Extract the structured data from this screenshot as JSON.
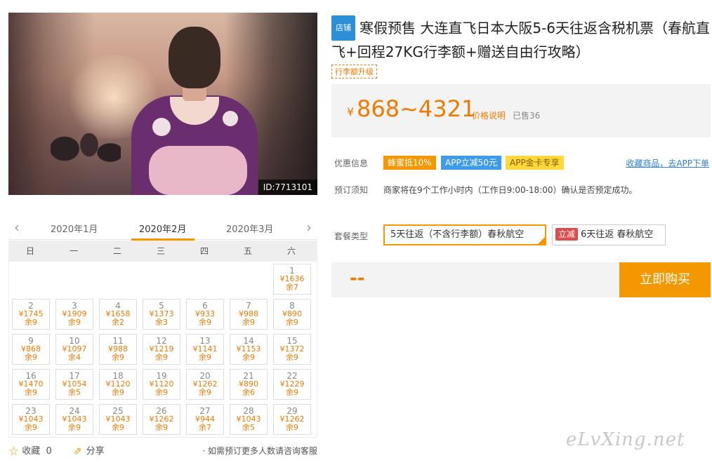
{
  "photo": {
    "id_label": "ID:7713101"
  },
  "calendar": {
    "months": [
      "2020年1月",
      "2020年2月",
      "2020年3月"
    ],
    "weekdays": [
      "日",
      "一",
      "二",
      "三",
      "四",
      "五",
      "六"
    ],
    "prev_arrow": "‹",
    "next_arrow": "›",
    "days": [
      {
        "n": "1",
        "p": "¥1636",
        "r": "余7"
      },
      {
        "n": "2",
        "p": "¥1745",
        "r": "余9"
      },
      {
        "n": "3",
        "p": "¥1909",
        "r": "余9"
      },
      {
        "n": "4",
        "p": "¥1658",
        "r": "余2"
      },
      {
        "n": "5",
        "p": "¥1373",
        "r": "余3"
      },
      {
        "n": "6",
        "p": "¥933",
        "r": "余9"
      },
      {
        "n": "7",
        "p": "¥988",
        "r": "余9"
      },
      {
        "n": "8",
        "p": "¥890",
        "r": "余9"
      },
      {
        "n": "9",
        "p": "¥868",
        "r": "余9"
      },
      {
        "n": "10",
        "p": "¥1097",
        "r": "余4"
      },
      {
        "n": "11",
        "p": "¥988",
        "r": "余9"
      },
      {
        "n": "12",
        "p": "¥1219",
        "r": "余9"
      },
      {
        "n": "13",
        "p": "¥1141",
        "r": "余9"
      },
      {
        "n": "14",
        "p": "¥1153",
        "r": "余9"
      },
      {
        "n": "15",
        "p": "¥1372",
        "r": "余9"
      },
      {
        "n": "16",
        "p": "¥1470",
        "r": "余9"
      },
      {
        "n": "17",
        "p": "¥1054",
        "r": "余5"
      },
      {
        "n": "18",
        "p": "¥1120",
        "r": "余9"
      },
      {
        "n": "19",
        "p": "¥1120",
        "r": "余9"
      },
      {
        "n": "20",
        "p": "¥1262",
        "r": "余9"
      },
      {
        "n": "21",
        "p": "¥890",
        "r": "余6"
      },
      {
        "n": "22",
        "p": "¥1229",
        "r": "余9"
      },
      {
        "n": "23",
        "p": "¥1043",
        "r": "余9"
      },
      {
        "n": "24",
        "p": "¥1043",
        "r": "余9"
      },
      {
        "n": "25",
        "p": "¥1043",
        "r": "余9"
      },
      {
        "n": "26",
        "p": "¥1262",
        "r": "余9"
      },
      {
        "n": "27",
        "p": "¥944",
        "r": "余7"
      },
      {
        "n": "28",
        "p": "¥1043",
        "r": "余5"
      },
      {
        "n": "29",
        "p": "¥1262",
        "r": "余9"
      }
    ]
  },
  "footer": {
    "fav_label": "收藏",
    "fav_count": "0",
    "share_label": "分享",
    "note": "· 如需预订更多人数请咨询客服"
  },
  "product": {
    "shop_tag": "店铺",
    "title": "寒假预售 大连直飞日本大阪5-6天往返含税机票（春航直飞+回程27KG行李额+赠送自由行攻略）",
    "luggage_tag": "行李额升级",
    "price_yen": "¥",
    "price_range": "868~4321",
    "price_note": "价格说明",
    "sold": "已售36"
  },
  "offers": {
    "label": "优惠信息",
    "promo_a": "蜂蜜抵10%",
    "promo_b": "APP立减50元",
    "promo_c": "APP金卡专享",
    "fav_link": "收藏商品，去APP下单"
  },
  "booking": {
    "label": "预订须知",
    "note": "商家将在9个工作小时内（工作日9:00-18:00）确认是否预定成功。"
  },
  "packages": {
    "label": "套餐类型",
    "selected": "5天往返（不含行李额）春秋航空",
    "other_tag": "立减",
    "other": "6天往返 春秋航空"
  },
  "buy": {
    "price_placeholder": "--",
    "button": "立即购买"
  },
  "watermark": "eLvXing.net"
}
